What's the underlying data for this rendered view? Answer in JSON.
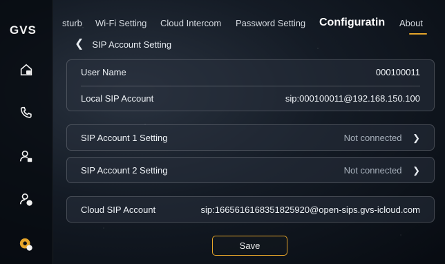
{
  "app": {
    "logo": "GVS"
  },
  "sidebar": {
    "items": [
      {
        "icon": "home-lock-icon"
      },
      {
        "icon": "phone-icon"
      },
      {
        "icon": "user-lock-icon"
      },
      {
        "icon": "user-call-icon"
      },
      {
        "icon": "settings-icon"
      }
    ],
    "accent": "#e6a52a"
  },
  "tabs": [
    {
      "label": "sturb"
    },
    {
      "label": "Wi-Fi Setting"
    },
    {
      "label": "Cloud Intercom"
    },
    {
      "label": "Password Setting"
    },
    {
      "label": "Configuratin",
      "active": true
    },
    {
      "label": "About"
    }
  ],
  "page": {
    "title": "SIP Account Setting"
  },
  "account": {
    "user_name_label": "User Name",
    "user_name_value": "000100011",
    "local_sip_label": "Local SIP Account",
    "local_sip_value": "sip:000100011@192.168.150.100"
  },
  "sip1": {
    "label": "SIP Account 1 Setting",
    "status": "Not connected"
  },
  "sip2": {
    "label": "SIP Account 2 Setting",
    "status": "Not connected"
  },
  "cloud": {
    "label": "Cloud SIP Account",
    "value": "sip:1665616168351825920@open-sips.gvs-icloud.com"
  },
  "actions": {
    "save_label": "Save"
  }
}
